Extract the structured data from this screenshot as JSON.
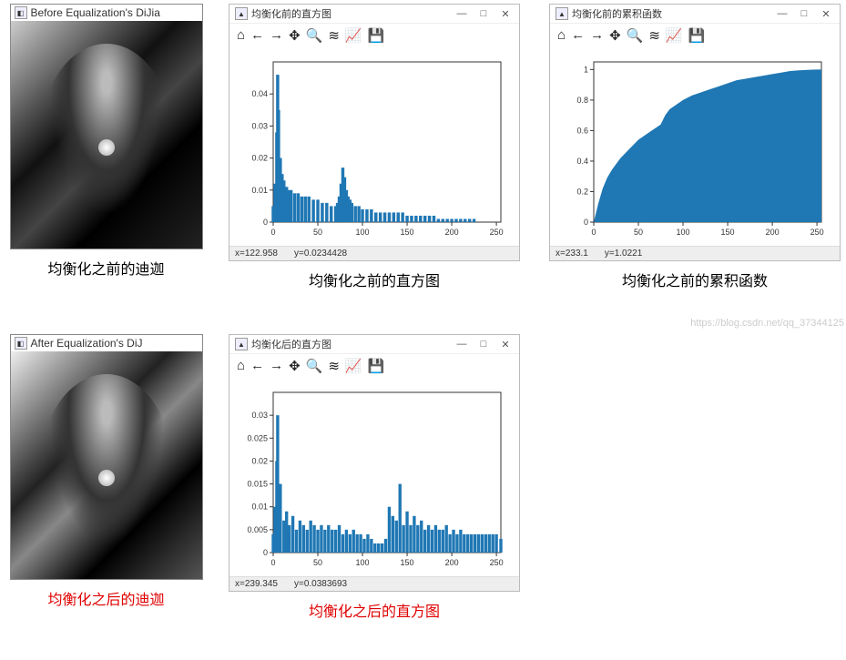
{
  "image_before": {
    "title": "Before Equalization's DiJia",
    "caption": "均衡化之前的迪迦"
  },
  "image_after": {
    "title": "After Equalization's DiJ",
    "caption": "均衡化之后的迪迦"
  },
  "hist_before_win": {
    "title": "均衡化前的直方图",
    "status_x": "x=122.958",
    "status_y": "y=0.0234428",
    "caption": "均衡化之前的直方图"
  },
  "cdf_before_win": {
    "title": "均衡化前的累积函数",
    "status_x": "x=233.1",
    "status_y": "y=1.0221",
    "caption": "均衡化之前的累积函数"
  },
  "hist_after_win": {
    "title": "均衡化后的直方图",
    "status_x": "x=239.345",
    "status_y": "y=0.0383693",
    "caption": "均衡化之后的直方图"
  },
  "window_controls": {
    "min": "—",
    "max": "□",
    "close": "✕"
  },
  "toolbar_icons": {
    "home": "⌂",
    "back": "←",
    "fwd": "→",
    "pan": "✥",
    "zoom": "🔍",
    "subplot": "≋",
    "axes": "📈",
    "save": "💾"
  },
  "watermark": "https://blog.csdn.net/qq_37344125",
  "chart_data": [
    {
      "id": "hist_before",
      "type": "bar",
      "xlim": [
        0,
        255
      ],
      "ylim": [
        0,
        0.05
      ],
      "xticks": [
        0,
        50,
        100,
        150,
        200,
        250
      ],
      "yticks": [
        0.0,
        0.01,
        0.02,
        0.03,
        0.04
      ],
      "x": [
        0,
        2,
        4,
        5,
        6,
        8,
        10,
        12,
        15,
        18,
        20,
        24,
        28,
        32,
        36,
        40,
        45,
        50,
        55,
        60,
        65,
        70,
        72,
        74,
        76,
        78,
        80,
        82,
        84,
        86,
        88,
        92,
        96,
        100,
        105,
        110,
        115,
        120,
        125,
        130,
        135,
        140,
        145,
        150,
        155,
        160,
        165,
        170,
        175,
        180,
        185,
        190,
        195,
        200,
        205,
        210,
        215,
        220,
        225,
        230,
        235,
        240,
        245,
        250,
        255
      ],
      "y": [
        0.005,
        0.012,
        0.028,
        0.046,
        0.035,
        0.02,
        0.015,
        0.013,
        0.011,
        0.01,
        0.01,
        0.009,
        0.009,
        0.008,
        0.008,
        0.008,
        0.007,
        0.007,
        0.006,
        0.006,
        0.005,
        0.005,
        0.006,
        0.008,
        0.012,
        0.017,
        0.014,
        0.01,
        0.008,
        0.007,
        0.006,
        0.005,
        0.005,
        0.004,
        0.004,
        0.004,
        0.003,
        0.003,
        0.003,
        0.003,
        0.003,
        0.003,
        0.003,
        0.002,
        0.002,
        0.002,
        0.002,
        0.002,
        0.002,
        0.002,
        0.001,
        0.001,
        0.001,
        0.001,
        0.001,
        0.001,
        0.001,
        0.001,
        0.001,
        0.0,
        0.0,
        0.0,
        0.0,
        0.0,
        0.0
      ]
    },
    {
      "id": "cdf_before",
      "type": "area",
      "xlim": [
        0,
        255
      ],
      "ylim": [
        0,
        1.05
      ],
      "xticks": [
        0,
        50,
        100,
        150,
        200,
        250
      ],
      "yticks": [
        0.0,
        0.2,
        0.4,
        0.6,
        0.8,
        1.0
      ],
      "x": [
        0,
        5,
        10,
        15,
        20,
        25,
        30,
        35,
        40,
        45,
        50,
        55,
        60,
        65,
        70,
        75,
        80,
        85,
        90,
        95,
        100,
        110,
        120,
        130,
        140,
        150,
        160,
        170,
        180,
        190,
        200,
        210,
        220,
        230,
        240,
        250,
        255
      ],
      "y": [
        0.0,
        0.12,
        0.22,
        0.29,
        0.34,
        0.38,
        0.42,
        0.45,
        0.48,
        0.51,
        0.54,
        0.56,
        0.58,
        0.6,
        0.62,
        0.64,
        0.7,
        0.74,
        0.76,
        0.78,
        0.8,
        0.83,
        0.85,
        0.87,
        0.89,
        0.91,
        0.93,
        0.94,
        0.95,
        0.96,
        0.97,
        0.98,
        0.99,
        0.995,
        0.998,
        1.0,
        1.0
      ]
    },
    {
      "id": "hist_after",
      "type": "bar",
      "xlim": [
        0,
        255
      ],
      "ylim": [
        0,
        0.035
      ],
      "xticks": [
        0,
        50,
        100,
        150,
        200,
        250
      ],
      "yticks": [
        0.0,
        0.005,
        0.01,
        0.015,
        0.02,
        0.025,
        0.03
      ],
      "x": [
        0,
        2,
        4,
        5,
        8,
        12,
        15,
        18,
        22,
        26,
        30,
        34,
        38,
        42,
        46,
        50,
        54,
        58,
        62,
        66,
        70,
        74,
        78,
        82,
        86,
        90,
        94,
        98,
        102,
        106,
        110,
        114,
        118,
        122,
        126,
        130,
        134,
        138,
        142,
        146,
        150,
        154,
        158,
        162,
        166,
        170,
        174,
        178,
        182,
        186,
        190,
        194,
        198,
        202,
        206,
        210,
        214,
        218,
        222,
        226,
        230,
        234,
        238,
        242,
        246,
        250,
        255
      ],
      "y": [
        0.004,
        0.01,
        0.02,
        0.03,
        0.015,
        0.007,
        0.009,
        0.006,
        0.008,
        0.005,
        0.007,
        0.006,
        0.005,
        0.007,
        0.006,
        0.005,
        0.006,
        0.005,
        0.006,
        0.005,
        0.005,
        0.006,
        0.004,
        0.005,
        0.004,
        0.005,
        0.004,
        0.004,
        0.003,
        0.004,
        0.003,
        0.002,
        0.002,
        0.002,
        0.003,
        0.01,
        0.008,
        0.007,
        0.015,
        0.006,
        0.009,
        0.006,
        0.008,
        0.006,
        0.007,
        0.005,
        0.006,
        0.005,
        0.006,
        0.005,
        0.005,
        0.006,
        0.004,
        0.005,
        0.004,
        0.005,
        0.004,
        0.004,
        0.004,
        0.004,
        0.004,
        0.004,
        0.004,
        0.004,
        0.004,
        0.004,
        0.003
      ]
    }
  ]
}
